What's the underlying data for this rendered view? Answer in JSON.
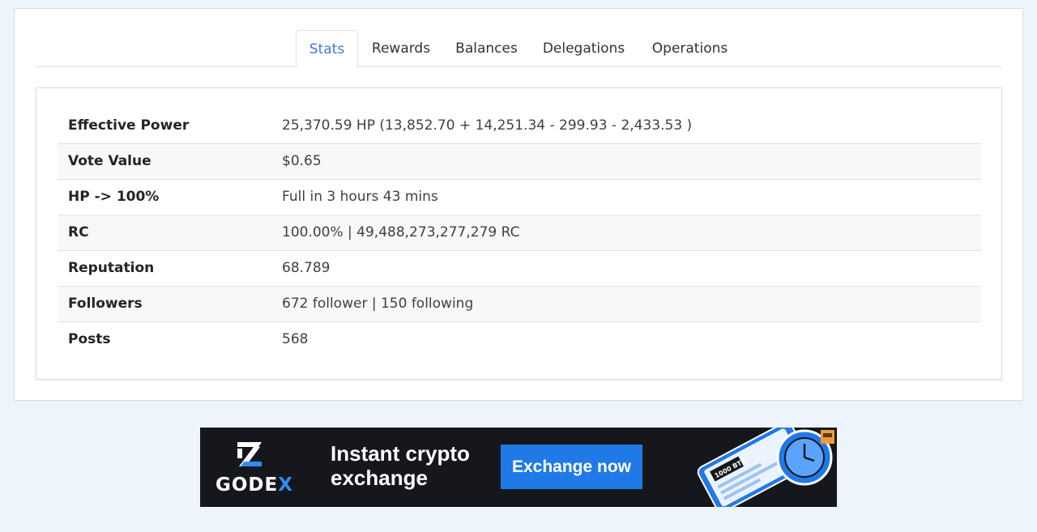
{
  "tabs": [
    {
      "label": "Stats",
      "active": true
    },
    {
      "label": "Rewards",
      "active": false
    },
    {
      "label": "Balances",
      "active": false
    },
    {
      "label": "Delegations",
      "active": false
    },
    {
      "label": "Operations",
      "active": false
    }
  ],
  "stats": [
    {
      "label": "Effective Power",
      "value": "25,370.59 HP (13,852.70 + 14,251.34 - 299.93 - 2,433.53 )"
    },
    {
      "label": "Vote Value",
      "value": "$0.65"
    },
    {
      "label": "HP -> 100%",
      "value": "Full in 3 hours 43 mins"
    },
    {
      "label": "RC",
      "value": "100.00% | 49,488,273,277,279 RC"
    },
    {
      "label": "Reputation",
      "value": "68.789"
    },
    {
      "label": "Followers",
      "value": "672 follower | 150 following"
    },
    {
      "label": "Posts",
      "value": "568"
    }
  ],
  "ad": {
    "brand_main": "GODE",
    "brand_x": "X",
    "headline": "Instant crypto exchange",
    "cta": "Exchange now",
    "phone_label": "1000 BTC"
  },
  "colors": {
    "page_background": "#eef4fb",
    "active_tab": "#3a7bd5",
    "ad_background": "#15171c",
    "ad_button": "#1f7ae8",
    "ad_accent": "#2f8cff"
  }
}
